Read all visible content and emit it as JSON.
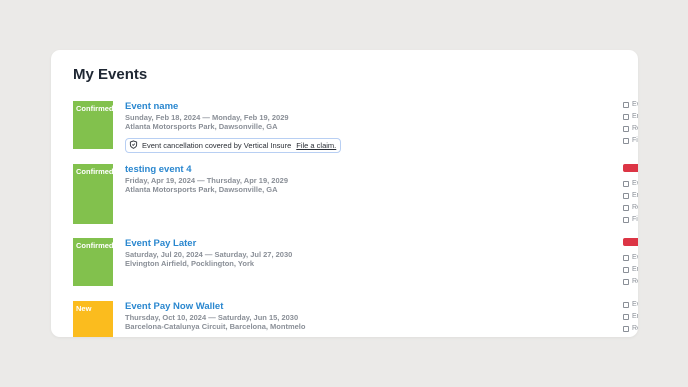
{
  "page_title": "My Events",
  "events": [
    {
      "status": "Confirmed",
      "name": "Event name",
      "dates": "Sunday, Feb 18, 2024 — Monday, Feb 19, 2029",
      "location": "Atlanta Motorsports Park, Dawsonville, GA",
      "insurance_text": "Event cancellation covered by Vertical Insure",
      "claim_link": "File a claim.",
      "actions": [
        "Ev",
        "Er",
        "Re",
        "Fi"
      ]
    },
    {
      "status": "Confirmed",
      "name": "testing event 4",
      "dates": "Friday, Apr 19, 2024 — Thursday, Apr 19, 2029",
      "location": "Atlanta Motorsports Park, Dawsonville, GA",
      "actions": [
        "Ev",
        "Er",
        "Re",
        "Fi"
      ]
    },
    {
      "status": "Confirmed",
      "name": "Event Pay Later",
      "dates": "Saturday, Jul 20, 2024 — Saturday, Jul 27, 2030",
      "location": "Elvington Airfield, Pocklington, York",
      "actions": [
        "Ev",
        "Er",
        "Re"
      ]
    },
    {
      "status": "New",
      "name": "Event Pay Now Wallet",
      "dates": "Thursday, Oct 10, 2024 — Saturday, Jun 15, 2030",
      "location": "Barcelona-Catalunya Circuit, Barcelona, Montmelo",
      "actions": [
        "Ev",
        "Er",
        "Re"
      ]
    }
  ],
  "colors": {
    "confirmed": "#82c14d",
    "new": "#fbbc1e",
    "link": "#2a87cf",
    "action_button": "#dc3545"
  }
}
